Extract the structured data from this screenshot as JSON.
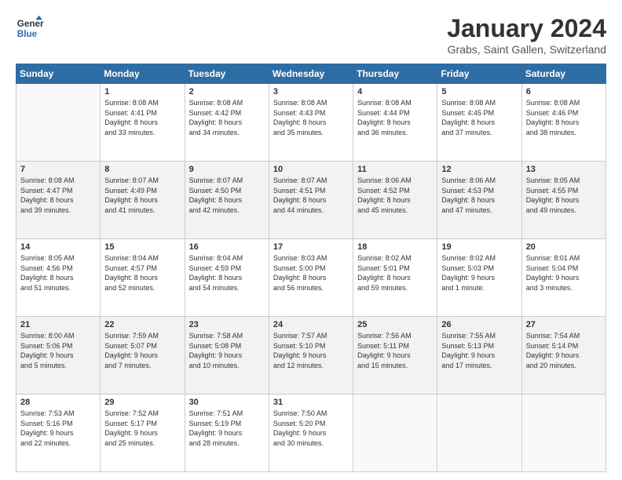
{
  "logo": {
    "line1": "General",
    "line2": "Blue"
  },
  "title": "January 2024",
  "subtitle": "Grabs, Saint Gallen, Switzerland",
  "days_of_week": [
    "Sunday",
    "Monday",
    "Tuesday",
    "Wednesday",
    "Thursday",
    "Friday",
    "Saturday"
  ],
  "weeks": [
    [
      {
        "num": "",
        "info": ""
      },
      {
        "num": "1",
        "info": "Sunrise: 8:08 AM\nSunset: 4:41 PM\nDaylight: 8 hours\nand 33 minutes."
      },
      {
        "num": "2",
        "info": "Sunrise: 8:08 AM\nSunset: 4:42 PM\nDaylight: 8 hours\nand 34 minutes."
      },
      {
        "num": "3",
        "info": "Sunrise: 8:08 AM\nSunset: 4:43 PM\nDaylight: 8 hours\nand 35 minutes."
      },
      {
        "num": "4",
        "info": "Sunrise: 8:08 AM\nSunset: 4:44 PM\nDaylight: 8 hours\nand 36 minutes."
      },
      {
        "num": "5",
        "info": "Sunrise: 8:08 AM\nSunset: 4:45 PM\nDaylight: 8 hours\nand 37 minutes."
      },
      {
        "num": "6",
        "info": "Sunrise: 8:08 AM\nSunset: 4:46 PM\nDaylight: 8 hours\nand 38 minutes."
      }
    ],
    [
      {
        "num": "7",
        "info": "Sunrise: 8:08 AM\nSunset: 4:47 PM\nDaylight: 8 hours\nand 39 minutes."
      },
      {
        "num": "8",
        "info": "Sunrise: 8:07 AM\nSunset: 4:49 PM\nDaylight: 8 hours\nand 41 minutes."
      },
      {
        "num": "9",
        "info": "Sunrise: 8:07 AM\nSunset: 4:50 PM\nDaylight: 8 hours\nand 42 minutes."
      },
      {
        "num": "10",
        "info": "Sunrise: 8:07 AM\nSunset: 4:51 PM\nDaylight: 8 hours\nand 44 minutes."
      },
      {
        "num": "11",
        "info": "Sunrise: 8:06 AM\nSunset: 4:52 PM\nDaylight: 8 hours\nand 45 minutes."
      },
      {
        "num": "12",
        "info": "Sunrise: 8:06 AM\nSunset: 4:53 PM\nDaylight: 8 hours\nand 47 minutes."
      },
      {
        "num": "13",
        "info": "Sunrise: 8:05 AM\nSunset: 4:55 PM\nDaylight: 8 hours\nand 49 minutes."
      }
    ],
    [
      {
        "num": "14",
        "info": "Sunrise: 8:05 AM\nSunset: 4:56 PM\nDaylight: 8 hours\nand 51 minutes."
      },
      {
        "num": "15",
        "info": "Sunrise: 8:04 AM\nSunset: 4:57 PM\nDaylight: 8 hours\nand 52 minutes."
      },
      {
        "num": "16",
        "info": "Sunrise: 8:04 AM\nSunset: 4:59 PM\nDaylight: 8 hours\nand 54 minutes."
      },
      {
        "num": "17",
        "info": "Sunrise: 8:03 AM\nSunset: 5:00 PM\nDaylight: 8 hours\nand 56 minutes."
      },
      {
        "num": "18",
        "info": "Sunrise: 8:02 AM\nSunset: 5:01 PM\nDaylight: 8 hours\nand 59 minutes."
      },
      {
        "num": "19",
        "info": "Sunrise: 8:02 AM\nSunset: 5:03 PM\nDaylight: 9 hours\nand 1 minute."
      },
      {
        "num": "20",
        "info": "Sunrise: 8:01 AM\nSunset: 5:04 PM\nDaylight: 9 hours\nand 3 minutes."
      }
    ],
    [
      {
        "num": "21",
        "info": "Sunrise: 8:00 AM\nSunset: 5:06 PM\nDaylight: 9 hours\nand 5 minutes."
      },
      {
        "num": "22",
        "info": "Sunrise: 7:59 AM\nSunset: 5:07 PM\nDaylight: 9 hours\nand 7 minutes."
      },
      {
        "num": "23",
        "info": "Sunrise: 7:58 AM\nSunset: 5:08 PM\nDaylight: 9 hours\nand 10 minutes."
      },
      {
        "num": "24",
        "info": "Sunrise: 7:57 AM\nSunset: 5:10 PM\nDaylight: 9 hours\nand 12 minutes."
      },
      {
        "num": "25",
        "info": "Sunrise: 7:56 AM\nSunset: 5:11 PM\nDaylight: 9 hours\nand 15 minutes."
      },
      {
        "num": "26",
        "info": "Sunrise: 7:55 AM\nSunset: 5:13 PM\nDaylight: 9 hours\nand 17 minutes."
      },
      {
        "num": "27",
        "info": "Sunrise: 7:54 AM\nSunset: 5:14 PM\nDaylight: 9 hours\nand 20 minutes."
      }
    ],
    [
      {
        "num": "28",
        "info": "Sunrise: 7:53 AM\nSunset: 5:16 PM\nDaylight: 9 hours\nand 22 minutes."
      },
      {
        "num": "29",
        "info": "Sunrise: 7:52 AM\nSunset: 5:17 PM\nDaylight: 9 hours\nand 25 minutes."
      },
      {
        "num": "30",
        "info": "Sunrise: 7:51 AM\nSunset: 5:19 PM\nDaylight: 9 hours\nand 28 minutes."
      },
      {
        "num": "31",
        "info": "Sunrise: 7:50 AM\nSunset: 5:20 PM\nDaylight: 9 hours\nand 30 minutes."
      },
      {
        "num": "",
        "info": ""
      },
      {
        "num": "",
        "info": ""
      },
      {
        "num": "",
        "info": ""
      }
    ]
  ]
}
